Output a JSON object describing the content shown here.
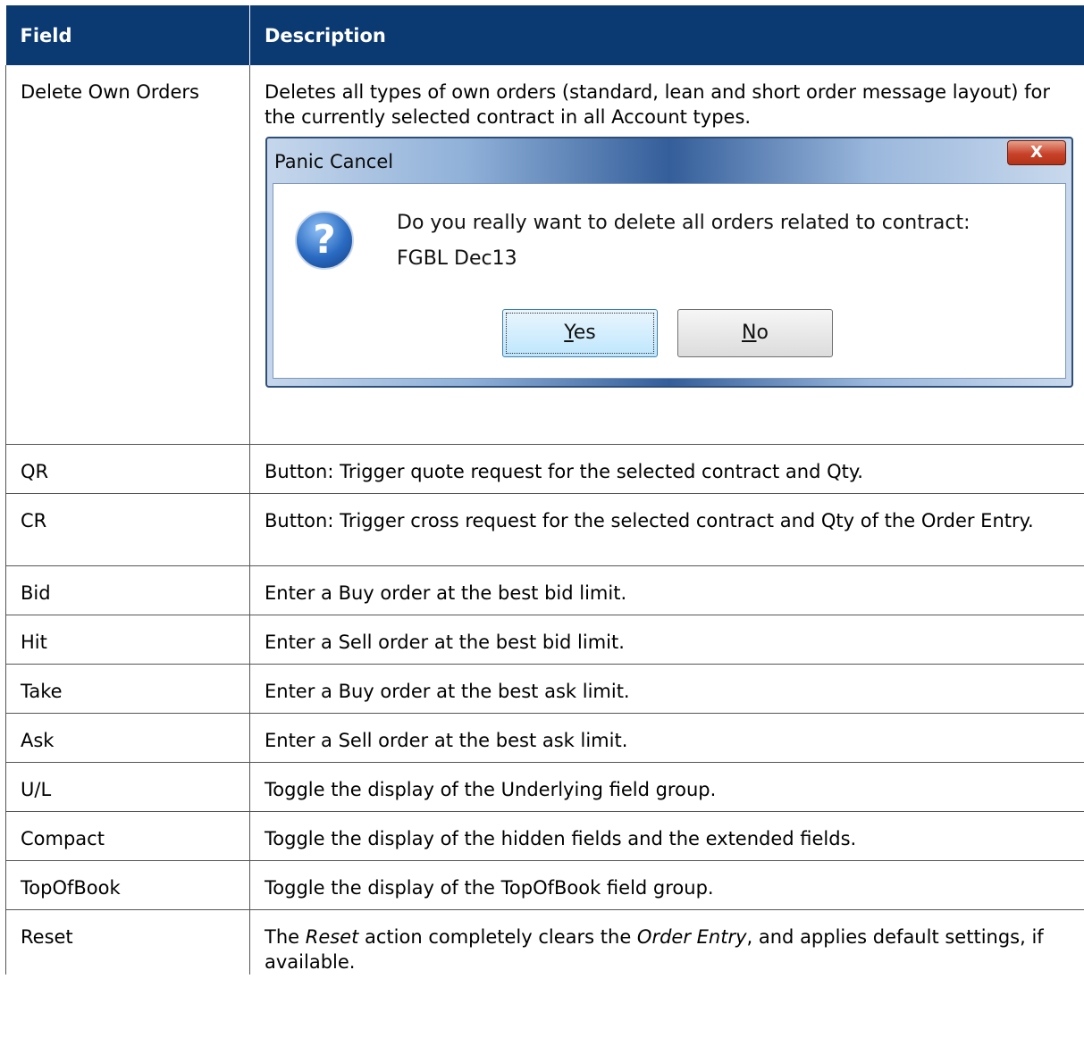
{
  "header": {
    "col_field": "Field",
    "col_description": "Description"
  },
  "rows": [
    {
      "field": "Delete Own Orders",
      "description": "Deletes all types of own orders (standard, lean and short order message layout) for the currently selected contract in all Account types."
    },
    {
      "field": "QR",
      "description": "Button: Trigger quote request for the selected contract and Qty."
    },
    {
      "field": "CR",
      "description": "Button: Trigger cross request for the selected contract and Qty of the Order Entry."
    },
    {
      "field": "Bid",
      "description": "Enter a Buy order at the best bid limit."
    },
    {
      "field": "Hit",
      "description": "Enter a Sell order at the best bid limit."
    },
    {
      "field": "Take",
      "description": "Enter a Buy order at the best ask limit."
    },
    {
      "field": "Ask",
      "description": "Enter a Sell order at the best ask limit."
    },
    {
      "field": "U/L",
      "description": "Toggle the display of the Underlying field group."
    },
    {
      "field": "Compact",
      "description": "Toggle the display of the hidden fields and the extended fields."
    },
    {
      "field": "TopOfBook",
      "description": "Toggle the display of the TopOfBook field group."
    },
    {
      "field": "Reset",
      "description_pre": "The ",
      "description_em1": "Reset",
      "description_mid": " action completely clears the ",
      "description_em2": "Order Entry",
      "description_post": ", and applies default settings, if available."
    }
  ],
  "dialog": {
    "title": "Panic Cancel",
    "close_glyph": "X",
    "icon": "question-icon",
    "icon_glyph": "?",
    "message_line1": "Do you really want to delete all orders related to contract:",
    "message_line2": "FGBL Dec13",
    "yes_mnemonic": "Y",
    "yes_rest": "es",
    "no_mnemonic": "N",
    "no_rest": "o"
  }
}
